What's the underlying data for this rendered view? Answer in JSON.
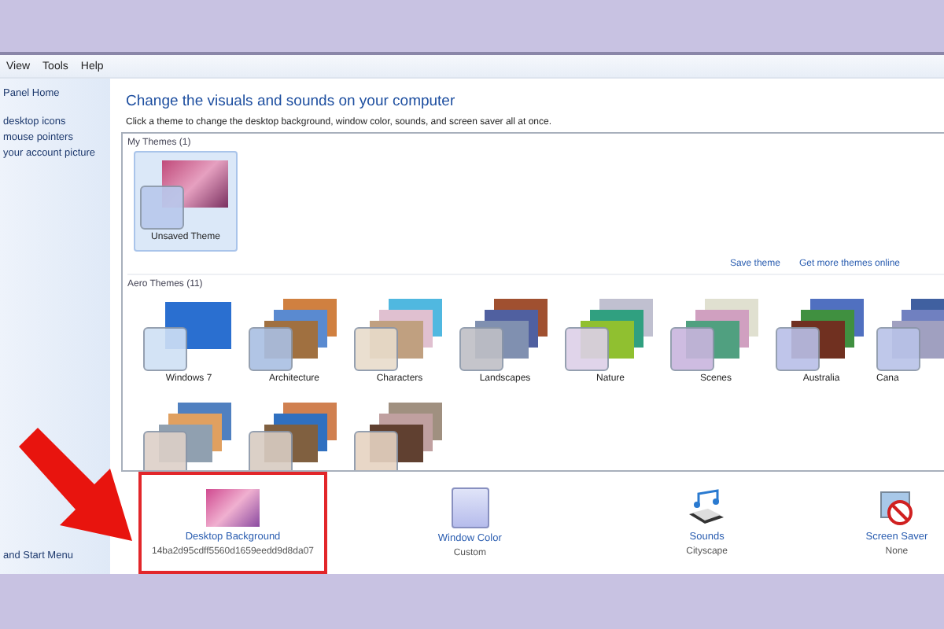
{
  "menu": [
    "View",
    "Tools",
    "Help"
  ],
  "sidebar": {
    "items": [
      "Panel Home",
      "desktop icons",
      "mouse pointers",
      "your account picture"
    ],
    "footer": "and Start Menu"
  },
  "heading": "Change the visuals and sounds on your computer",
  "subheading": "Click a theme to change the desktop background, window color, sounds, and screen saver all at once.",
  "my_themes": {
    "title": "My Themes (1)",
    "items": [
      {
        "label": "Unsaved Theme",
        "selected": true
      }
    ]
  },
  "links": [
    "Save theme",
    "Get more themes online"
  ],
  "aero_themes": {
    "title": "Aero Themes (11)",
    "items": [
      {
        "label": "Windows 7",
        "selected": false
      },
      {
        "label": "Architecture",
        "selected": false
      },
      {
        "label": "Characters",
        "selected": false
      },
      {
        "label": "Landscapes",
        "selected": false
      },
      {
        "label": "Nature",
        "selected": false
      },
      {
        "label": "Scenes",
        "selected": false
      },
      {
        "label": "Australia",
        "selected": false
      },
      {
        "label": "Cana",
        "selected": false
      },
      {
        "selected": false
      },
      {
        "selected": false
      },
      {
        "selected": false
      }
    ]
  },
  "bottom_bar": [
    {
      "kind": "background",
      "label": "Desktop Background",
      "value": "14ba2d95cdff5560d1659eedd9d8da07",
      "highlighted": true
    },
    {
      "kind": "color",
      "label": "Window Color",
      "value": "Custom",
      "highlighted": false
    },
    {
      "kind": "sounds",
      "label": "Sounds",
      "value": "Cityscape",
      "highlighted": false
    },
    {
      "kind": "screensaver",
      "label": "Screen Saver",
      "value": "None",
      "highlighted": false
    }
  ]
}
